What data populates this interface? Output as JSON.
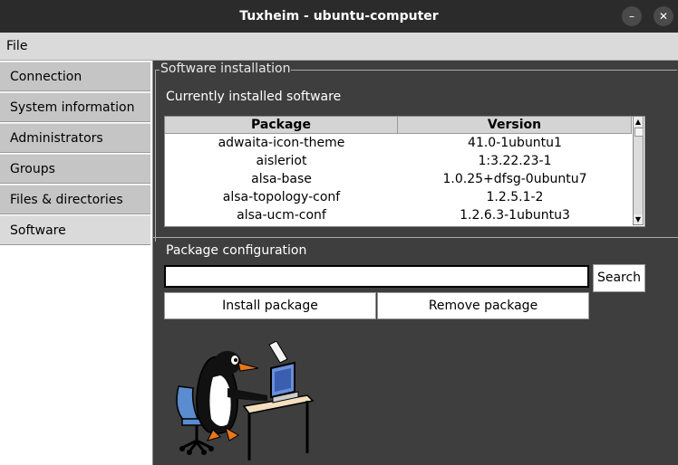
{
  "window": {
    "title": "Tuxheim - ubuntu-computer",
    "minimize_glyph": "–",
    "close_glyph": "✕"
  },
  "menubar": {
    "file": "File"
  },
  "sidebar": {
    "tabs": [
      {
        "label": "Connection"
      },
      {
        "label": "System information"
      },
      {
        "label": "Administrators"
      },
      {
        "label": "Groups"
      },
      {
        "label": "Files & directories"
      },
      {
        "label": "Software"
      }
    ],
    "active": "Software"
  },
  "software": {
    "group_title": "Software installation",
    "installed_label": "Currently installed software",
    "columns": {
      "package": "Package",
      "version": "Version"
    },
    "rows": [
      {
        "package": "adwaita-icon-theme",
        "version": "41.0-1ubuntu1"
      },
      {
        "package": "aisleriot",
        "version": "1:3.22.23-1"
      },
      {
        "package": "alsa-base",
        "version": "1.0.25+dfsg-0ubuntu7"
      },
      {
        "package": "alsa-topology-conf",
        "version": "1.2.5.1-2"
      },
      {
        "package": "alsa-ucm-conf",
        "version": "1.2.6.3-1ubuntu3"
      }
    ],
    "config_label": "Package configuration",
    "search_value": "",
    "search_button": "Search",
    "install_button": "Install package",
    "remove_button": "Remove package",
    "mascot": "tux-at-computer-image"
  }
}
